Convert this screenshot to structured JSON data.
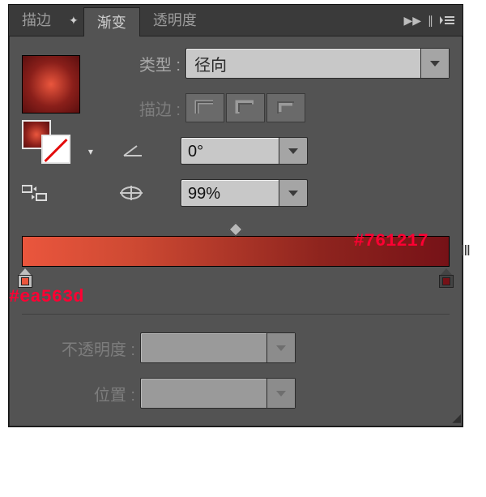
{
  "tabs": {
    "stroke": "描边",
    "gradient": "渐变",
    "transparency": "透明度"
  },
  "type_row": {
    "label": "类型 :",
    "value": "径向"
  },
  "stroke_row": {
    "label": "描边 :"
  },
  "angle": {
    "value": "0°"
  },
  "aspect": {
    "value": "99%"
  },
  "bottom": {
    "opacity_label": "不透明度 :",
    "location_label": "位置 :"
  },
  "annotations": {
    "right_hex": "#761217",
    "left_hex": "#ea563d"
  }
}
